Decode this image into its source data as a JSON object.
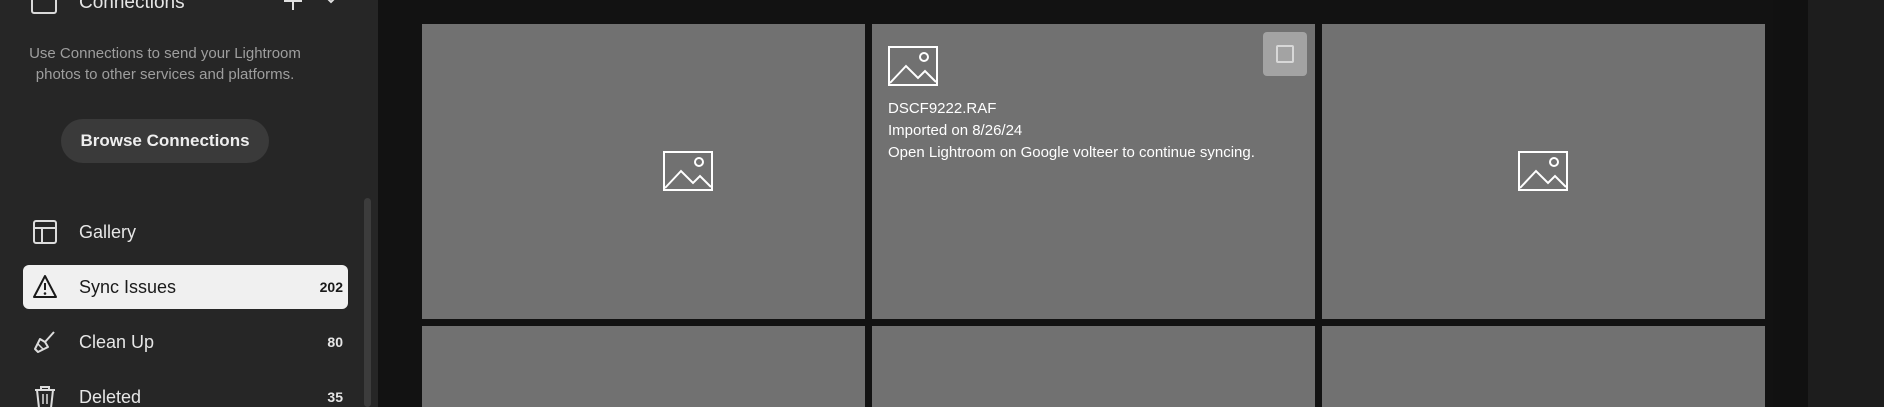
{
  "sidebar": {
    "connections": {
      "title": "Connections",
      "description": "Use Connections to send your Lightroom photos to other services and platforms.",
      "browse_label": "Browse Connections"
    },
    "items": [
      {
        "label": "Gallery",
        "count": "",
        "icon": "gallery-icon"
      },
      {
        "label": "Sync Issues",
        "count": "202",
        "icon": "warning-icon"
      },
      {
        "label": "Clean Up",
        "count": "80",
        "icon": "broom-icon"
      },
      {
        "label": "Deleted",
        "count": "35",
        "icon": "trash-icon"
      }
    ]
  },
  "grid": {
    "selected_tile": {
      "filename": "DSCF9222.RAF",
      "imported": "Imported on 8/26/24",
      "message": "Open Lightroom on Google volteer to continue syncing."
    }
  },
  "colors": {
    "sidebar_bg": "#262626",
    "main_bg": "#121212",
    "tile_bg": "#717171",
    "active_item_bg": "#f0f0f0"
  }
}
